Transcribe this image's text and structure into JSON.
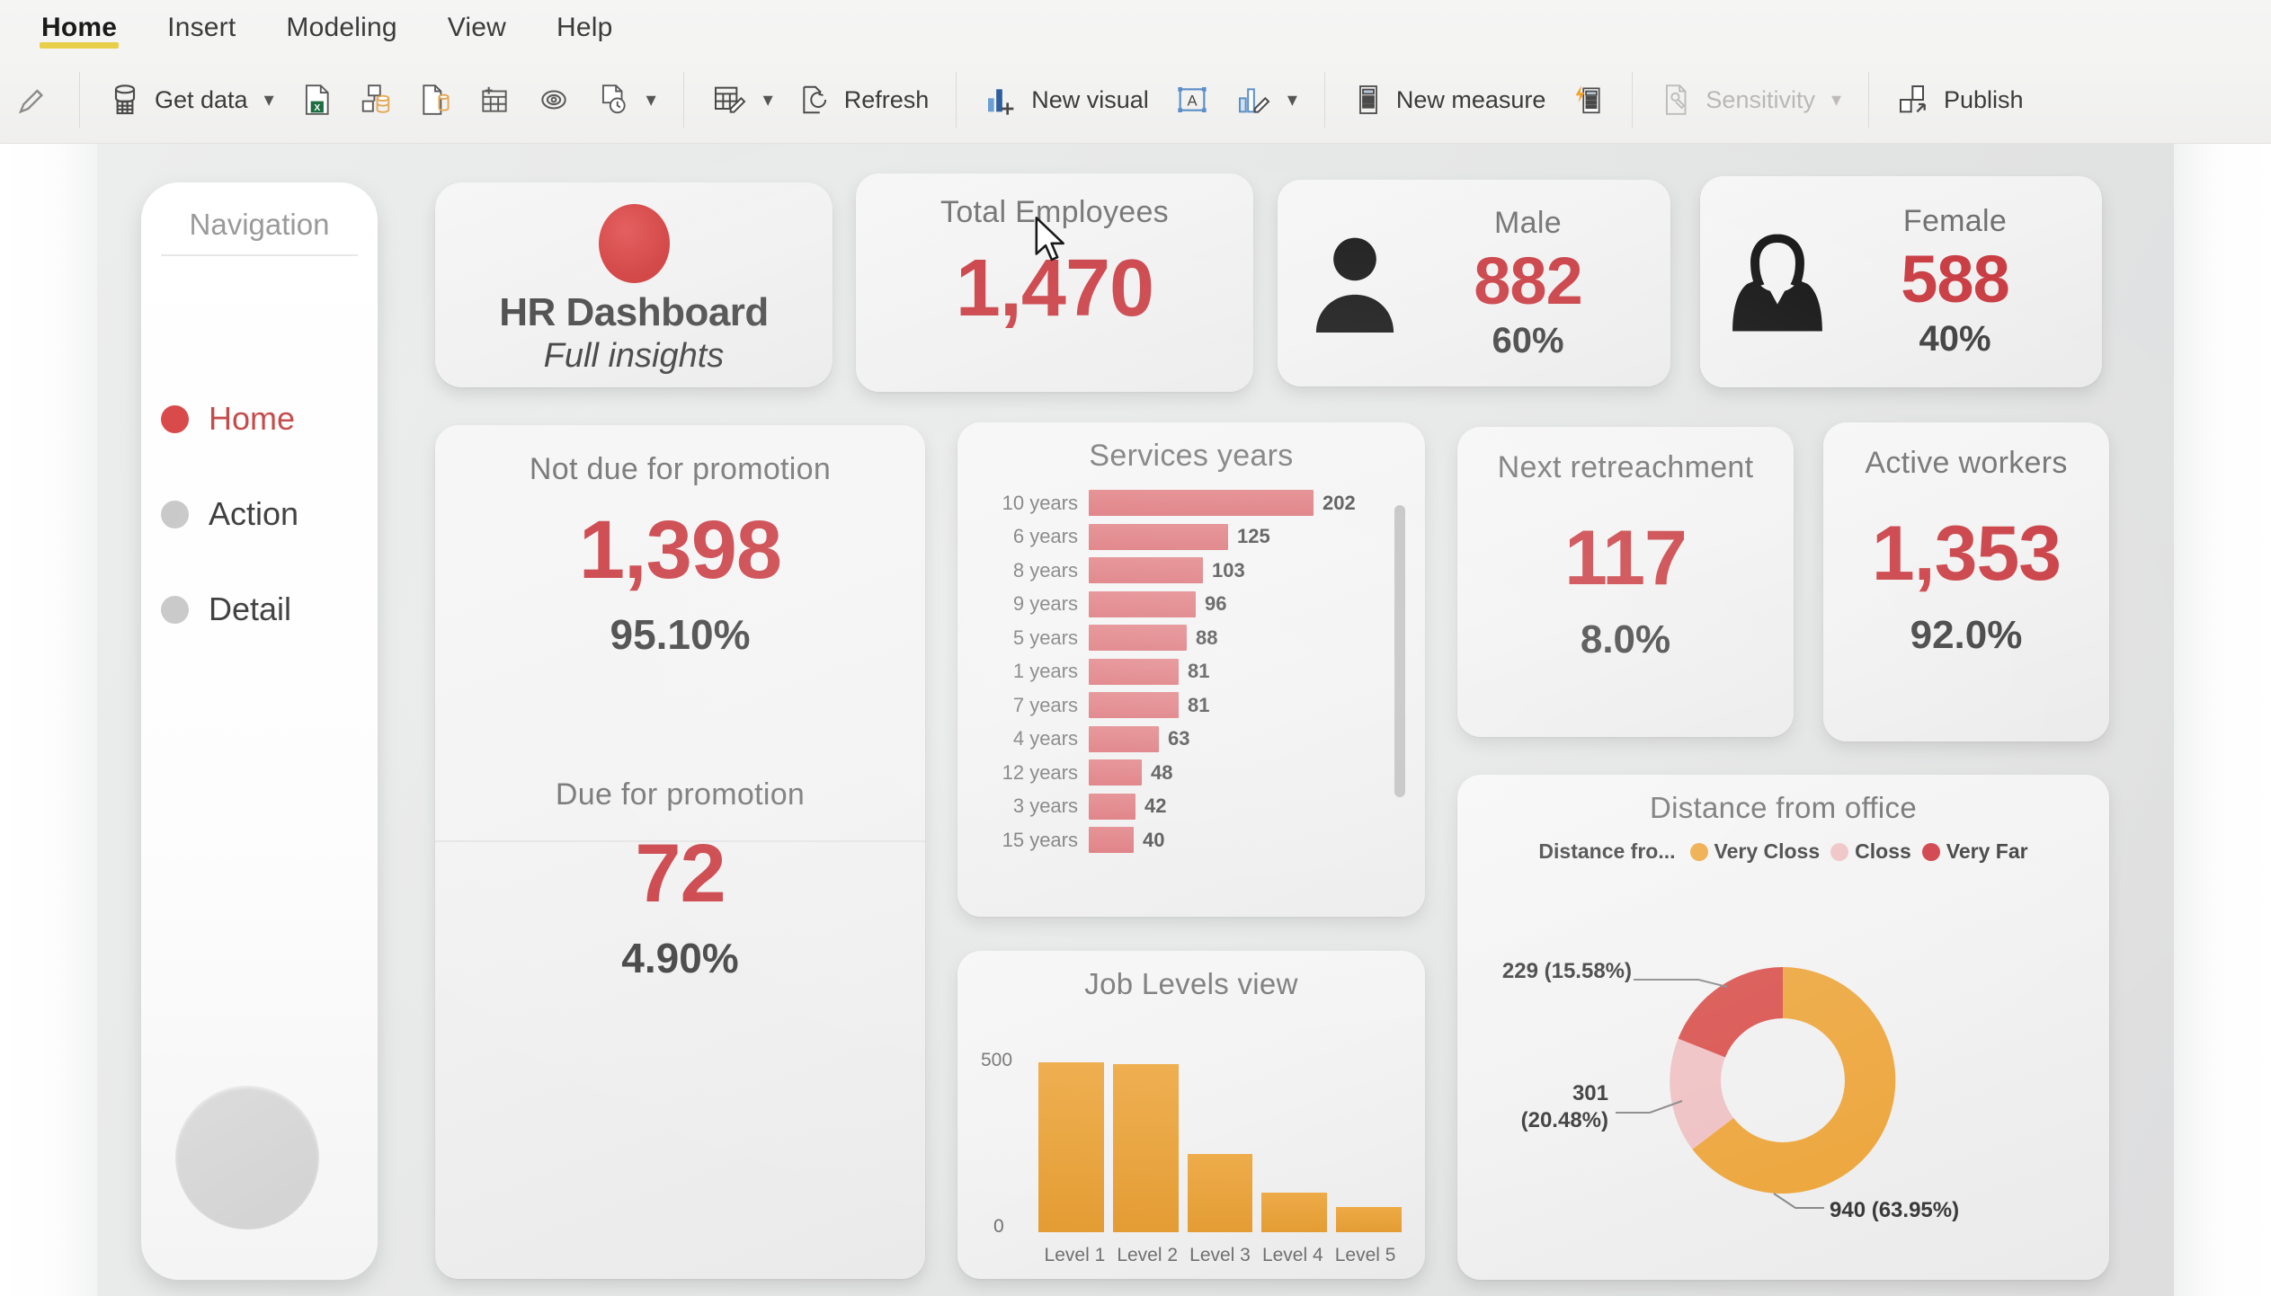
{
  "ribbon": {
    "tabs": [
      {
        "label": "Home",
        "active": true
      },
      {
        "label": "Insert",
        "active": false
      },
      {
        "label": "Modeling",
        "active": false
      },
      {
        "label": "View",
        "active": false
      },
      {
        "label": "Help",
        "active": false
      }
    ],
    "accent_underline": "#e8cf4a",
    "toolbar": {
      "format_painter": "",
      "get_data": "Get data",
      "excel": "",
      "sql_server": "",
      "enter_data": "",
      "dataverse": "",
      "recent_sources": "",
      "transform_data": "",
      "refresh": "Refresh",
      "new_visual": "New visual",
      "text_box": "",
      "more_visuals": "",
      "new_measure": "New measure",
      "quick_measure": "",
      "sensitivity": "Sensitivity",
      "publish": "Publish"
    }
  },
  "navigation": {
    "title": "Navigation",
    "items": [
      {
        "label": "Home",
        "active": true,
        "dot_color": "#d94b4b"
      },
      {
        "label": "Action",
        "active": false,
        "dot_color": "#c9c9c9"
      },
      {
        "label": "Detail",
        "active": false,
        "dot_color": "#c9c9c9"
      }
    ]
  },
  "dashboard": {
    "title": "HR Dashboard",
    "subtitle": "Full insights",
    "accent": "#c8393f",
    "orange": "#e39a2f",
    "cards": {
      "total_employees": {
        "title": "Total Employees",
        "value": "1,470"
      },
      "male": {
        "title": "Male",
        "value": "882",
        "pct": "60%",
        "icon": "male-avatar-icon"
      },
      "female": {
        "title": "Female",
        "value": "588",
        "pct": "40%",
        "icon": "female-avatar-icon"
      },
      "not_due_promotion": {
        "title": "Not due for promotion",
        "value": "1,398",
        "pct": "95.10%"
      },
      "due_promotion": {
        "title": "Due for promotion",
        "value": "72",
        "pct": "4.90%"
      },
      "next_retrenchment": {
        "title": "Next retreachment",
        "value": "117",
        "pct": "8.0%"
      },
      "active_workers": {
        "title": "Active workers",
        "value": "1,353",
        "pct": "92.0%"
      }
    }
  },
  "chart_data": [
    {
      "type": "bar",
      "orientation": "horizontal",
      "title": "Services years",
      "xlabel": "",
      "ylabel": "",
      "grid": false,
      "legend": "none",
      "data_labels": true,
      "xlim": [
        0,
        202
      ],
      "categories": [
        "10 years",
        "6 years",
        "8 years",
        "9 years",
        "5 years",
        "1 years",
        "7 years",
        "4 years",
        "12 years",
        "3 years",
        "15 years"
      ],
      "values": [
        202,
        125,
        103,
        96,
        88,
        81,
        81,
        63,
        48,
        42,
        40
      ],
      "bar_color": "#d9686e",
      "scrollable": true
    },
    {
      "type": "bar",
      "orientation": "vertical",
      "title": "Job Levels view",
      "xlabel": "",
      "ylabel": "",
      "grid": false,
      "legend": "none",
      "data_labels": false,
      "ylim": [
        0,
        500
      ],
      "ytick_labels": [
        "500",
        "0"
      ],
      "categories": [
        "Level 1",
        "Level 2",
        "Level 3",
        "Level 4",
        "Level 5"
      ],
      "values": [
        510,
        505,
        235,
        120,
        75
      ],
      "bar_color": "#e39a2f"
    },
    {
      "type": "pie",
      "subtype": "donut",
      "title": "Distance from office",
      "legend_title": "Distance fro...",
      "legend_position": "top",
      "labels": [
        "Very Closs",
        "Closs",
        "Very Far"
      ],
      "values": [
        940,
        301,
        229
      ],
      "percents": [
        "63.95%",
        "20.48%",
        "15.58%"
      ],
      "data_labels": [
        "940 (63.95%)",
        "301\n(20.48%)",
        "229 (15.58%)"
      ],
      "colors": [
        "#eda73f",
        "#efc2c4",
        "#d9534f"
      ]
    }
  ]
}
